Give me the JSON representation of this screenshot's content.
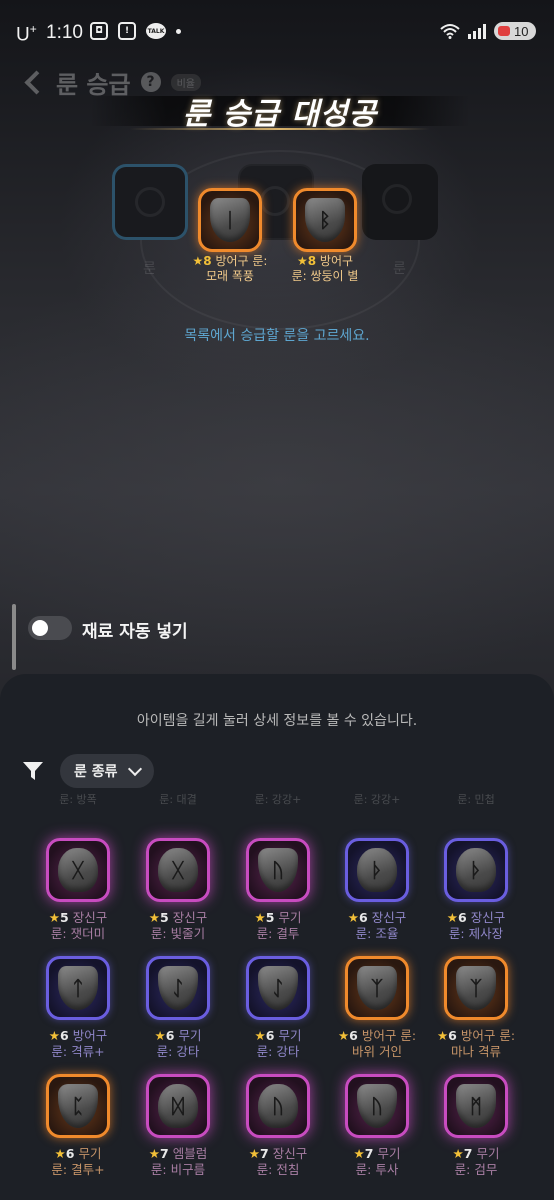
{
  "status_bar": {
    "carrier": "U",
    "carrier_sup": "+",
    "time": "1:10",
    "talk": "TALK",
    "battery": "10"
  },
  "header": {
    "title": "룬 승급",
    "help": "?",
    "badge": "비율"
  },
  "banner": {
    "text": "룬 승급 대성공"
  },
  "slot_side_label": "룬",
  "selected": [
    {
      "stars": "★8",
      "line1": "방어구 룬:",
      "line2": "모래 폭풍",
      "rune": "ᛁ",
      "color": "orange"
    },
    {
      "stars": "★8",
      "line1": "방어구",
      "line2": "룬: 쌍둥이 별",
      "rune": "ᛒ",
      "color": "orange"
    }
  ],
  "upgrade_hint": "목록에서 승급할 룬을 고르세요.",
  "auto_fill": {
    "label": "재료 자동 넣기",
    "enabled": false
  },
  "sheet": {
    "hint": "아이템을 길게 눌러 상세 정보를 볼 수 있습니다.",
    "filter_label": "룬 종류"
  },
  "faded_row": [
    "룬: 방폭",
    "룬: 대결",
    "룬: 강강+",
    "룬: 강강+",
    "룬: 민첩"
  ],
  "items": [
    [
      {
        "stars": "★5",
        "line1": "장신구",
        "line2": "룬: 잿더미",
        "rune": "ᚷ",
        "color": "pink",
        "shape": "round"
      },
      {
        "stars": "★5",
        "line1": "장신구",
        "line2": "룬: 빛줄기",
        "rune": "ᚷ",
        "color": "pink",
        "shape": "round"
      },
      {
        "stars": "★5",
        "line1": "무기",
        "line2": "룬: 결투",
        "rune": "ᚢ",
        "color": "pink",
        "shape": "shield"
      },
      {
        "stars": "★6",
        "line1": "장신구",
        "line2": "룬: 조율",
        "rune": "ᚦ",
        "color": "purple",
        "shape": "round"
      },
      {
        "stars": "★6",
        "line1": "장신구",
        "line2": "룬: 제사장",
        "rune": "ᚦ",
        "color": "purple",
        "shape": "round"
      }
    ],
    [
      {
        "stars": "★6",
        "line1": "방어구",
        "line2": "룬: 격류+",
        "rune": "ᛏ",
        "color": "purple",
        "shape": "tri"
      },
      {
        "stars": "★6",
        "line1": "무기",
        "line2": "룬: 강타",
        "rune": "ᛇ",
        "color": "purple",
        "shape": "shield"
      },
      {
        "stars": "★6",
        "line1": "무기",
        "line2": "룬: 강타",
        "rune": "ᛇ",
        "color": "purple",
        "shape": "shield"
      },
      {
        "stars": "★6",
        "line1": "방어구 룬:",
        "line2": "바위 거인",
        "rune": "ᛉ",
        "color": "orange",
        "shape": "tri"
      },
      {
        "stars": "★6",
        "line1": "방어구 룬:",
        "line2": "마나 격류",
        "rune": "ᛉ",
        "color": "orange",
        "shape": "tri"
      }
    ],
    [
      {
        "stars": "★6",
        "line1": "무기",
        "line2": "룬: 결투+",
        "rune": "ᛈ",
        "color": "orange",
        "shape": "shield"
      },
      {
        "stars": "★7",
        "line1": "엠블럼",
        "line2": "룬: 비구름",
        "rune": "ᛞ",
        "color": "pink",
        "shape": "round"
      },
      {
        "stars": "★7",
        "line1": "장신구",
        "line2": "룬: 전침",
        "rune": "ᚢ",
        "color": "pink",
        "shape": "round"
      },
      {
        "stars": "★7",
        "line1": "무기",
        "line2": "룬: 투사",
        "rune": "ᚢ",
        "color": "pink",
        "shape": "shield"
      },
      {
        "stars": "★7",
        "line1": "무기",
        "line2": "룬: 검무",
        "rune": "ᛗ",
        "color": "pink",
        "shape": "tri"
      }
    ]
  ],
  "colors": {
    "orange": "#f08a2c",
    "pink": "#c84cc0",
    "purple": "#6a5ee0",
    "hint_blue": "#5ea6d0",
    "star_gold": "#f2c038"
  }
}
